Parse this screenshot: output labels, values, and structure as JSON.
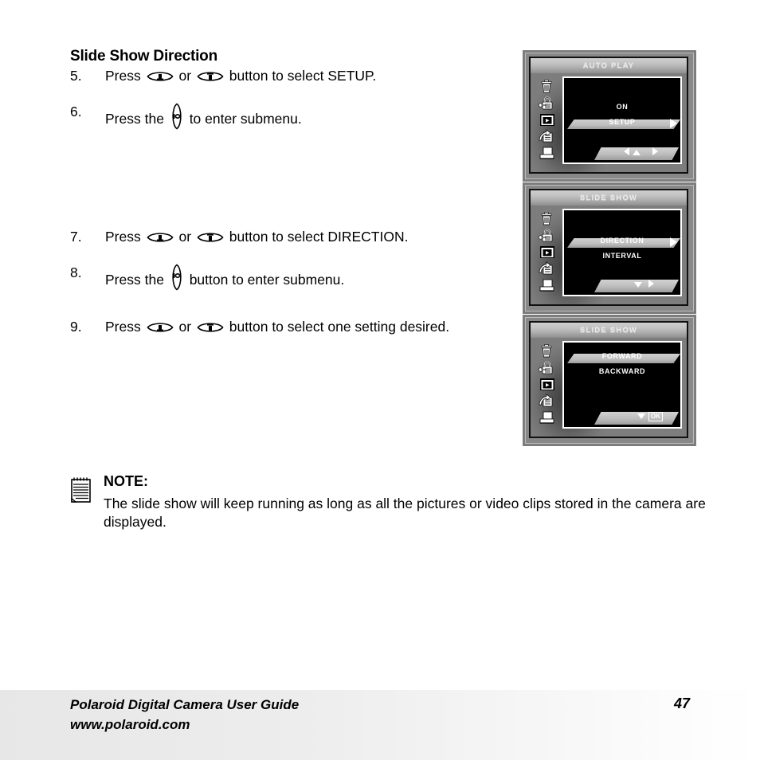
{
  "page": {
    "section_title": "Slide Show Direction"
  },
  "steps": [
    {
      "number": "5.",
      "text_before": "Press",
      "text_middle": "or",
      "text_after": "button to select SETUP.",
      "glyphs": [
        "up-down-button",
        "up-down-button"
      ]
    },
    {
      "number": "6.",
      "text_before": "Press the",
      "text_after": "to enter submenu.",
      "glyphs": [
        "right-button"
      ]
    },
    {
      "number": "7.",
      "text_before": "Press",
      "text_middle": "or",
      "text_after": "button to select DIRECTION.",
      "glyphs": [
        "up-down-button",
        "up-down-button"
      ]
    },
    {
      "number": "8.",
      "text_before": "Press the",
      "text_after": "button to enter submenu.",
      "glyphs": [
        "right-button"
      ]
    },
    {
      "number": "9.",
      "text_before": "Press",
      "text_middle": "or",
      "text_after": "button to select one setting desired.",
      "glyphs": [
        "up-down-button",
        "up-down-button"
      ]
    }
  ],
  "note": {
    "icon": "notepad-icon",
    "title": "NOTE:",
    "body": "The slide show will keep running as long as all the pictures or video clips stored in the camera are displayed."
  },
  "lcd_panels": [
    {
      "title": "AUTO PLAY",
      "sidebar_icons": [
        "trash-icon",
        "lock-icon",
        "playback-icon",
        "transfer-icon",
        "print-icon"
      ],
      "active_icon_index": 2,
      "menu_items": [
        "ON",
        "SETUP"
      ],
      "selected_index": 1,
      "nav_hints": [
        "left-triangle",
        "up-triangle",
        "right-triangle"
      ],
      "ok_badge": ""
    },
    {
      "title": "SLIDE SHOW",
      "sidebar_icons": [
        "trash-icon",
        "lock-icon",
        "playback-icon",
        "transfer-icon",
        "print-icon"
      ],
      "active_icon_index": 2,
      "menu_items": [
        "DIRECTION",
        "INTERVAL"
      ],
      "selected_index": 0,
      "nav_hints": [
        "down-triangle",
        "right-triangle"
      ],
      "ok_badge": ""
    },
    {
      "title": "SLIDE SHOW",
      "sidebar_icons": [
        "trash-icon",
        "lock-icon",
        "playback-icon",
        "transfer-icon",
        "print-icon"
      ],
      "active_icon_index": 2,
      "menu_items": [
        "FORWARD",
        "BACKWARD"
      ],
      "selected_index": 0,
      "nav_hints": [
        "down-triangle"
      ],
      "ok_badge": "OK"
    }
  ],
  "footer": {
    "line1": "Polaroid Digital Camera User Guide",
    "line2": "www.polaroid.com",
    "page_number": "47"
  },
  "colors": {
    "page_bg": "#ffffff",
    "text": "#000000",
    "footer_bg": "#e7e7e7",
    "lcd_frame": "#888888",
    "lcd_screen": "#000000",
    "lcd_highlight": "#c2c2c2"
  }
}
